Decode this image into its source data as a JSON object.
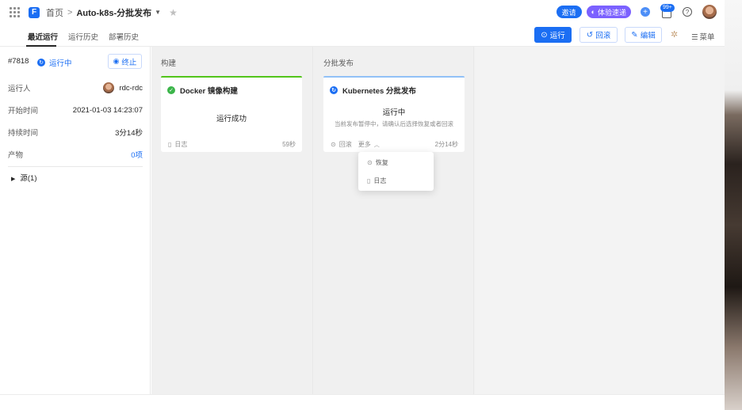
{
  "header": {
    "breadcrumb_home": "首页",
    "breadcrumb_sep": ">",
    "pipeline_name": "Auto-k8s-分批发布",
    "invite_label": "邀请",
    "experience_label": "体验速递",
    "notif_count": "99+"
  },
  "tabs": {
    "recent": "最近运行",
    "history": "运行历史",
    "deploy": "部署历史"
  },
  "toolbar": {
    "run": "运行",
    "rollback": "回滚",
    "edit": "编辑",
    "menu": "菜单"
  },
  "run_info": {
    "id": "#7818",
    "status": "运行中",
    "stop_label": "终止",
    "runner_label": "运行人",
    "runner_value": "rdc-rdc",
    "start_label": "开始时间",
    "start_value": "2021-01-03 14:23:07",
    "duration_label": "持续时间",
    "duration_value": "3分14秒",
    "artifacts_label": "产物",
    "artifacts_value": "0项",
    "source_label": "源(1)"
  },
  "stages": {
    "build_title": "构建",
    "deploy_title": "分批发布",
    "build_card": {
      "name": "Docker 镜像构建",
      "status": "运行成功",
      "log": "日志",
      "duration": "59秒",
      "accent": "#52c41a"
    },
    "deploy_card": {
      "name": "Kubernetes 分批发布",
      "status": "运行中",
      "hint": "当前发布暂停中，请确认后选择恢复或者回滚",
      "rollback": "回滚",
      "more": "更多",
      "duration": "2分14秒",
      "accent": "#91c1f7"
    }
  },
  "dropdown": {
    "resume": "恢复",
    "log": "日志"
  },
  "colors": {
    "primary": "#1b6ef3",
    "success": "#3bb54a",
    "purple": "#7b61ff"
  }
}
